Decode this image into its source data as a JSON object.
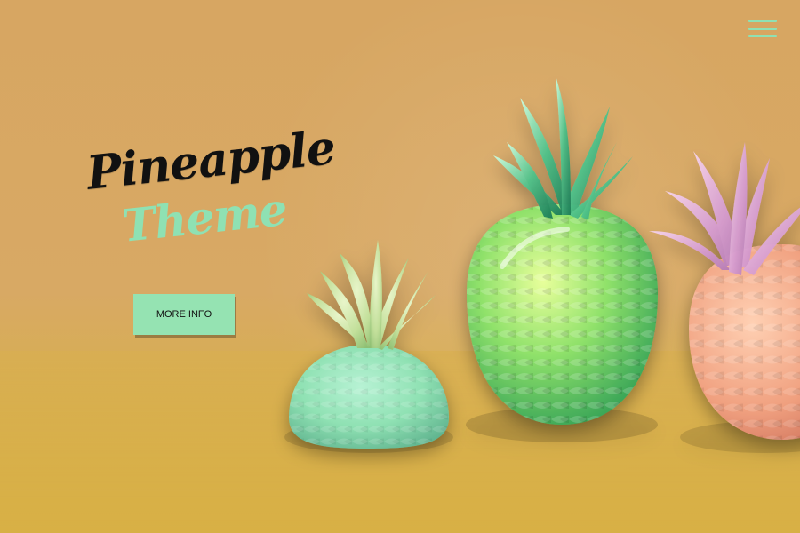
{
  "header": {
    "menu_icon": "hamburger-menu-icon"
  },
  "hero": {
    "title_line1": "Pineapple",
    "title_line2": "Theme",
    "cta_label": "MORE INFO"
  },
  "colors": {
    "background": "#d8a964",
    "accent": "#8fe1b3",
    "title": "#111111"
  },
  "image": {
    "description": "Three stylized pineapples (mint, green glass, and pink/peach) on a warm yellow surface."
  }
}
